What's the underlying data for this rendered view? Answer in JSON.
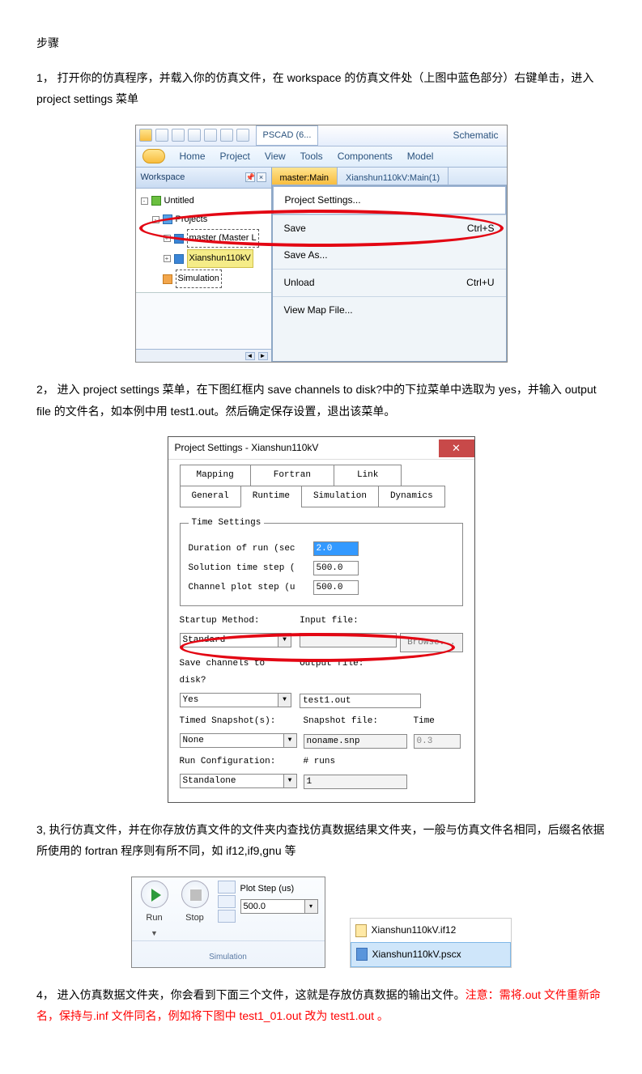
{
  "heading": "步骤",
  "step1": {
    "text": "1，  打开你的仿真程序，并载入你的仿真文件，在 workspace 的仿真文件处（上图中蓝色部分）右键单击，进入 project settings 菜单"
  },
  "shot1": {
    "titlebox": "PSCAD (6...",
    "schematic": "Schematic",
    "ribbon": [
      "Home",
      "Project",
      "View",
      "Tools",
      "Components",
      "Model"
    ],
    "workspace_label": "Workspace",
    "pin": "📌",
    "tree": {
      "untitled": "Untitled",
      "projects": "Projects",
      "master": "master (Master L",
      "selected": "Xianshun110kV",
      "simulation": "Simulation"
    },
    "tabs": {
      "t1": "master:Main",
      "t2": "Xianshun110kV:Main(1)"
    },
    "ctx": {
      "ps": "Project Settings...",
      "save": "Save",
      "save_k": "Ctrl+S",
      "saveas": "Save As...",
      "unload": "Unload",
      "unload_k": "Ctrl+U",
      "viewmap": "View Map File..."
    }
  },
  "step2": {
    "text": "2， 进入 project settings 菜单，在下图红框内 save channels to disk?中的下拉菜单中选取为 yes，并输入 output file 的文件名，如本例中用 test1.out。然后确定保存设置，退出该菜单。"
  },
  "shot2": {
    "title": "Project Settings - Xianshun110kV",
    "tabs": [
      "Mapping",
      "Fortran",
      "Link",
      "General",
      "Runtime",
      "Simulation",
      "Dynamics"
    ],
    "ts_legend": "Time Settings",
    "dur_l": "Duration of run (sec",
    "dur_v": "2.0",
    "sts_l": "Solution time step (",
    "sts_v": "500.0",
    "cps_l": "Channel plot step (u",
    "cps_v": "500.0",
    "startup_l": "Startup Method:",
    "startup_v": "Standard",
    "input_l": "Input file:",
    "input_v": "",
    "browse": "Browse...",
    "savech_l": "Save channels to disk?",
    "savech_v": "Yes",
    "outfile_l": "Output file:",
    "outfile_v": "test1.out",
    "timed_l": "Timed Snapshot(s):",
    "timed_v": "None",
    "snap_l": "Snapshot file:",
    "snap_v": "noname.snp",
    "time_l": "Time",
    "time_v": "0.3",
    "runcfg_l": "Run Configuration:",
    "runcfg_v": "Standalone",
    "nruns_l": "# runs",
    "nruns_v": "1"
  },
  "step3": {
    "text": "3, 执行仿真文件，并在你存放仿真文件的文件夹内查找仿真数据结果文件夹，一般与仿真文件名相同，后缀名依据所使用的 fortran 程序则有所不同，如 if12,if9,gnu 等"
  },
  "shot3": {
    "run": "Run",
    "stop": "Stop",
    "plotstep_l": "Plot Step (us)",
    "plotstep_v": "500.0",
    "simulation": "Simulation",
    "file1": "Xianshun110kV.if12",
    "file2": "Xianshun110kV.pscx"
  },
  "step4": {
    "lead": "4，  进入仿真数据文件夹，你会看到下面三个文件，这就是存放仿真数据的输出文件。",
    "red": "注意：需将.out 文件重新命名，保持与.inf 文件同名，例如将下图中 test1_01.out 改为 test1.out 。"
  }
}
